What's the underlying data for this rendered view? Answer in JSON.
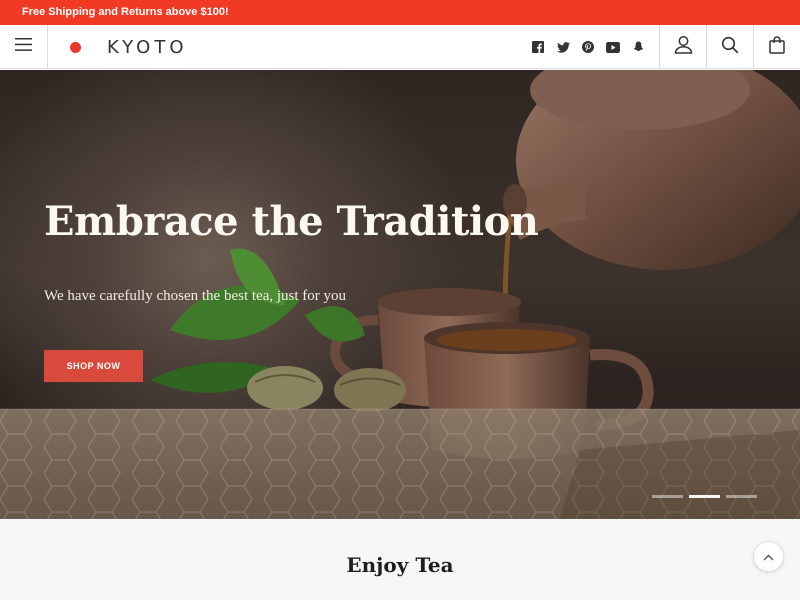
{
  "announcement": {
    "text": "Free Shipping and Returns above $100!"
  },
  "header": {
    "menu_icon": "hamburger-menu-icon",
    "logo_text": "KYOTO",
    "social_icons": [
      "facebook-icon",
      "twitter-icon",
      "pinterest-icon",
      "youtube-icon",
      "snapchat-icon"
    ],
    "actions": [
      "account-icon",
      "search-icon",
      "cart-icon"
    ]
  },
  "hero": {
    "title": "Embrace the Tradition",
    "subtitle": "We have carefully chosen the best tea, just for you",
    "cta_label": "SHOP NOW",
    "slides_total": 3,
    "active_slide": 2
  },
  "section": {
    "title": "Enjoy Tea",
    "scroll_top_icon": "chevron-up-icon"
  },
  "colors": {
    "announcement_bg": "#f03a24",
    "logo_dot": "#e8392b",
    "cta_bg": "#d74a3c",
    "text_dark": "#1e1e1e"
  }
}
